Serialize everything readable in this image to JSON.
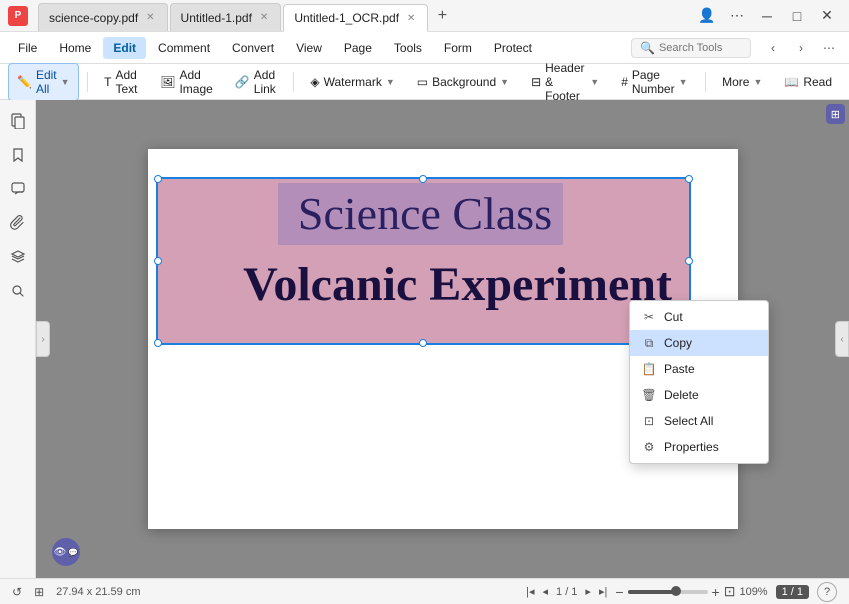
{
  "tabs": [
    {
      "label": "science-copy.pdf",
      "active": false,
      "closeable": true
    },
    {
      "label": "Untitled-1.pdf",
      "active": false,
      "closeable": true
    },
    {
      "label": "Untitled-1_OCR.pdf",
      "active": true,
      "closeable": true
    }
  ],
  "menu": {
    "items": [
      "Home",
      "Edit",
      "Comment",
      "Convert",
      "View",
      "Page",
      "Tools",
      "Form",
      "Protect"
    ],
    "active": "Edit",
    "search_placeholder": "Search Tools"
  },
  "toolbar": {
    "edit_all": "Edit All",
    "add_text": "Add Text",
    "add_image": "Add Image",
    "add_link": "Add Link",
    "watermark": "Watermark",
    "background": "Background",
    "header_footer": "Header & Footer",
    "page_number": "Page Number",
    "more": "More",
    "read": "Read"
  },
  "sidebar": {
    "icons": [
      "pages",
      "bookmark",
      "comment",
      "attachment",
      "layers",
      "search"
    ]
  },
  "document": {
    "title_line1": "Science Class",
    "title_line2": "Volcanic Experiment"
  },
  "context_menu": {
    "items": [
      {
        "label": "Cut",
        "icon": "scissors"
      },
      {
        "label": "Copy",
        "icon": "copy",
        "active": true
      },
      {
        "label": "Paste",
        "icon": "paste"
      },
      {
        "label": "Delete",
        "icon": "delete"
      },
      {
        "label": "Select All",
        "icon": "select-all"
      },
      {
        "label": "Properties",
        "icon": "properties"
      }
    ]
  },
  "status_bar": {
    "dimensions": "27.94 x 21.59 cm",
    "page_current": "1",
    "page_total": "1",
    "page_display": "1 / 1",
    "zoom": "109%",
    "badge": "1 / 1"
  },
  "colors": {
    "accent_blue": "#1a7fdf",
    "title_color1": "#2a2060",
    "title_color2": "#1a1040",
    "pink_bg": "#d4a0b5",
    "purple_overlay": "rgba(160,140,200,0.45)"
  }
}
